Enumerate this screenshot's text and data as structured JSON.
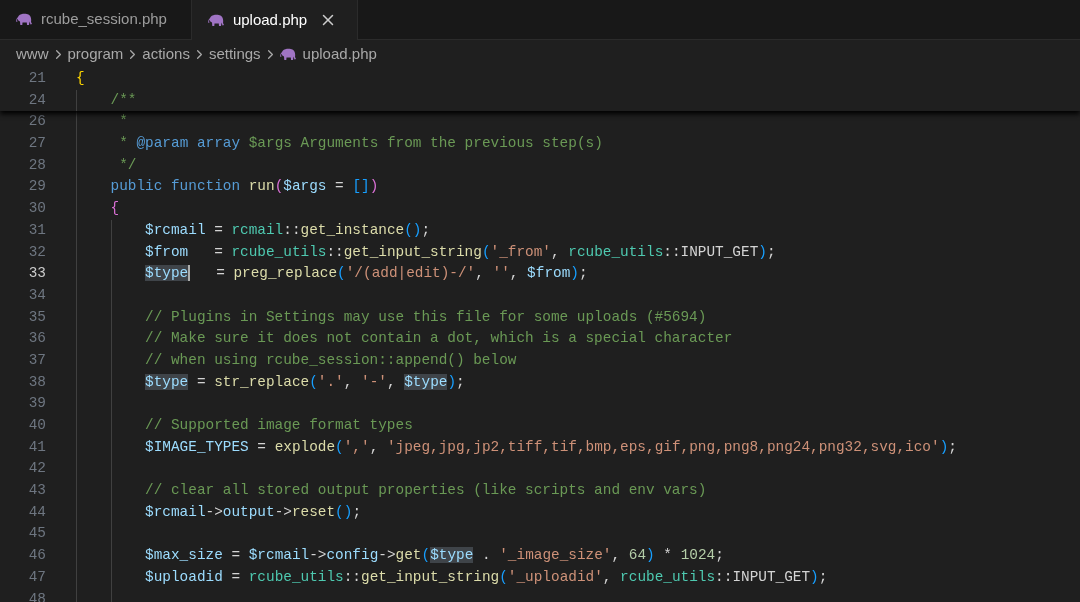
{
  "tabs": [
    {
      "label": "rcube_session.php",
      "selected": false
    },
    {
      "label": "upload.php",
      "selected": true
    }
  ],
  "breadcrumb": [
    {
      "label": "www",
      "kind": "folder"
    },
    {
      "label": "program",
      "kind": "folder"
    },
    {
      "label": "actions",
      "kind": "folder"
    },
    {
      "label": "settings",
      "kind": "folder"
    },
    {
      "label": "upload.php",
      "kind": "file"
    }
  ],
  "sticky_lines": [
    {
      "number": "21",
      "tokens": [
        {
          "text": "{",
          "kind": "b1"
        }
      ],
      "children": [
        {
          "number": "24",
          "tokens": [
            {
              "text": "/**",
              "kind": "com"
            }
          ]
        }
      ]
    }
  ],
  "lines": [
    {
      "number": "26",
      "tokens": [
        {
          "text": " *",
          "kind": "com"
        }
      ]
    },
    {
      "number": "27",
      "tokens": [
        {
          "text": " * ",
          "kind": "com"
        },
        {
          "text": "@param array",
          "kind": "kw"
        },
        {
          "text": " $args Arguments from the previous step(s)",
          "kind": "com"
        }
      ]
    },
    {
      "number": "28",
      "tokens": [
        {
          "text": " */",
          "kind": "com"
        }
      ]
    },
    {
      "number": "29",
      "tokens": [
        {
          "text": "public function",
          "kind": "kw"
        },
        {
          "text": " run",
          "kind": "fn"
        },
        {
          "text": "(",
          "kind": "b2"
        },
        {
          "text": "$args",
          "kind": "var"
        },
        {
          "text": " = ",
          "kind": "p"
        },
        {
          "text": "[",
          "kind": "b3"
        },
        {
          "text": "]",
          "kind": "b3"
        },
        {
          "text": ")",
          "kind": "b2"
        }
      ]
    },
    {
      "number": "30",
      "tokens": [
        {
          "text": "{",
          "kind": "b2"
        }
      ],
      "children": [
        {
          "number": "31",
          "tokens": [
            {
              "text": "$rcmail",
              "kind": "var"
            },
            {
              "text": " = ",
              "kind": "p"
            },
            {
              "text": "rcmail",
              "kind": "cls"
            },
            {
              "text": "::",
              "kind": "p"
            },
            {
              "text": "get_instance",
              "kind": "fn"
            },
            {
              "text": "(",
              "kind": "b3"
            },
            {
              "text": ")",
              "kind": "b3"
            },
            {
              "text": ";",
              "kind": "p"
            }
          ]
        },
        {
          "number": "32",
          "tokens": [
            {
              "text": "$from",
              "kind": "var"
            },
            {
              "text": "   = ",
              "kind": "p"
            },
            {
              "text": "rcube_utils",
              "kind": "cls"
            },
            {
              "text": "::",
              "kind": "p"
            },
            {
              "text": "get_input_string",
              "kind": "fn"
            },
            {
              "text": "(",
              "kind": "b3"
            },
            {
              "text": "'_from'",
              "kind": "str"
            },
            {
              "text": ", ",
              "kind": "p"
            },
            {
              "text": "rcube_utils",
              "kind": "cls"
            },
            {
              "text": "::INPUT_GET",
              "kind": "p"
            },
            {
              "text": ")",
              "kind": "b3"
            },
            {
              "text": ";",
              "kind": "p"
            }
          ]
        },
        {
          "number": "33",
          "current": true,
          "tokens": [
            {
              "text": "$type",
              "kind": "var",
              "highlight": true,
              "cursor": true
            },
            {
              "text": "   = ",
              "kind": "p"
            },
            {
              "text": "preg_replace",
              "kind": "fn"
            },
            {
              "text": "(",
              "kind": "b3"
            },
            {
              "text": "'/(add|edit)-/'",
              "kind": "str"
            },
            {
              "text": ", ",
              "kind": "p"
            },
            {
              "text": "''",
              "kind": "str"
            },
            {
              "text": ", ",
              "kind": "p"
            },
            {
              "text": "$from",
              "kind": "var"
            },
            {
              "text": ")",
              "kind": "b3"
            },
            {
              "text": ";",
              "kind": "p"
            }
          ]
        },
        {
          "number": "34"
        },
        {
          "number": "35",
          "tokens": [
            {
              "text": "// Plugins in Settings may use this file for some uploads (#5694)",
              "kind": "com"
            }
          ]
        },
        {
          "number": "36",
          "tokens": [
            {
              "text": "// Make sure it does not contain a dot, which is a special character",
              "kind": "com"
            }
          ]
        },
        {
          "number": "37",
          "tokens": [
            {
              "text": "// when using rcube_session::append() below",
              "kind": "com"
            }
          ]
        },
        {
          "number": "38",
          "tokens": [
            {
              "text": "$type",
              "kind": "var",
              "highlight": true
            },
            {
              "text": " = ",
              "kind": "p"
            },
            {
              "text": "str_replace",
              "kind": "fn"
            },
            {
              "text": "(",
              "kind": "b3"
            },
            {
              "text": "'.'",
              "kind": "str"
            },
            {
              "text": ", ",
              "kind": "p"
            },
            {
              "text": "'-'",
              "kind": "str"
            },
            {
              "text": ", ",
              "kind": "p"
            },
            {
              "text": "$type",
              "kind": "var",
              "highlight": true
            },
            {
              "text": ")",
              "kind": "b3"
            },
            {
              "text": ";",
              "kind": "p"
            }
          ]
        },
        {
          "number": "39"
        },
        {
          "number": "40",
          "tokens": [
            {
              "text": "// Supported image format types",
              "kind": "com"
            }
          ]
        },
        {
          "number": "41",
          "tokens": [
            {
              "text": "$IMAGE_TYPES",
              "kind": "var"
            },
            {
              "text": " = ",
              "kind": "p"
            },
            {
              "text": "explode",
              "kind": "fn"
            },
            {
              "text": "(",
              "kind": "b3"
            },
            {
              "text": "','",
              "kind": "str"
            },
            {
              "text": ", ",
              "kind": "p"
            },
            {
              "text": "'jpeg,jpg,jp2,tiff,tif,bmp,eps,gif,png,png8,png24,png32,svg,ico'",
              "kind": "str"
            },
            {
              "text": ")",
              "kind": "b3"
            },
            {
              "text": ";",
              "kind": "p"
            }
          ]
        },
        {
          "number": "42"
        },
        {
          "number": "43",
          "tokens": [
            {
              "text": "// clear all stored output properties (like scripts and env vars)",
              "kind": "com"
            }
          ]
        },
        {
          "number": "44",
          "tokens": [
            {
              "text": "$rcmail",
              "kind": "var"
            },
            {
              "text": "->",
              "kind": "p"
            },
            {
              "text": "output",
              "kind": "var"
            },
            {
              "text": "->",
              "kind": "p"
            },
            {
              "text": "reset",
              "kind": "fn"
            },
            {
              "text": "(",
              "kind": "b3"
            },
            {
              "text": ")",
              "kind": "b3"
            },
            {
              "text": ";",
              "kind": "p"
            }
          ]
        },
        {
          "number": "45"
        },
        {
          "number": "46",
          "tokens": [
            {
              "text": "$max_size",
              "kind": "var"
            },
            {
              "text": " = ",
              "kind": "p"
            },
            {
              "text": "$rcmail",
              "kind": "var"
            },
            {
              "text": "->",
              "kind": "p"
            },
            {
              "text": "config",
              "kind": "var"
            },
            {
              "text": "->",
              "kind": "p"
            },
            {
              "text": "get",
              "kind": "fn"
            },
            {
              "text": "(",
              "kind": "b3"
            },
            {
              "text": "$type",
              "kind": "var",
              "highlight": true
            },
            {
              "text": " . ",
              "kind": "p"
            },
            {
              "text": "'_image_size'",
              "kind": "str"
            },
            {
              "text": ", ",
              "kind": "p"
            },
            {
              "text": "64",
              "kind": "num"
            },
            {
              "text": ")",
              "kind": "b3"
            },
            {
              "text": " * ",
              "kind": "p"
            },
            {
              "text": "1024",
              "kind": "num"
            },
            {
              "text": ";",
              "kind": "p"
            }
          ]
        },
        {
          "number": "47",
          "tokens": [
            {
              "text": "$uploadid",
              "kind": "var"
            },
            {
              "text": " = ",
              "kind": "p"
            },
            {
              "text": "rcube_utils",
              "kind": "cls"
            },
            {
              "text": "::",
              "kind": "p"
            },
            {
              "text": "get_input_string",
              "kind": "fn"
            },
            {
              "text": "(",
              "kind": "b3"
            },
            {
              "text": "'_uploadid'",
              "kind": "str"
            },
            {
              "text": ", ",
              "kind": "p"
            },
            {
              "text": "rcube_utils",
              "kind": "cls"
            },
            {
              "text": "::INPUT_GET",
              "kind": "p"
            },
            {
              "text": ")",
              "kind": "b3"
            },
            {
              "text": ";",
              "kind": "p"
            }
          ]
        },
        {
          "number": "48"
        }
      ]
    }
  ]
}
